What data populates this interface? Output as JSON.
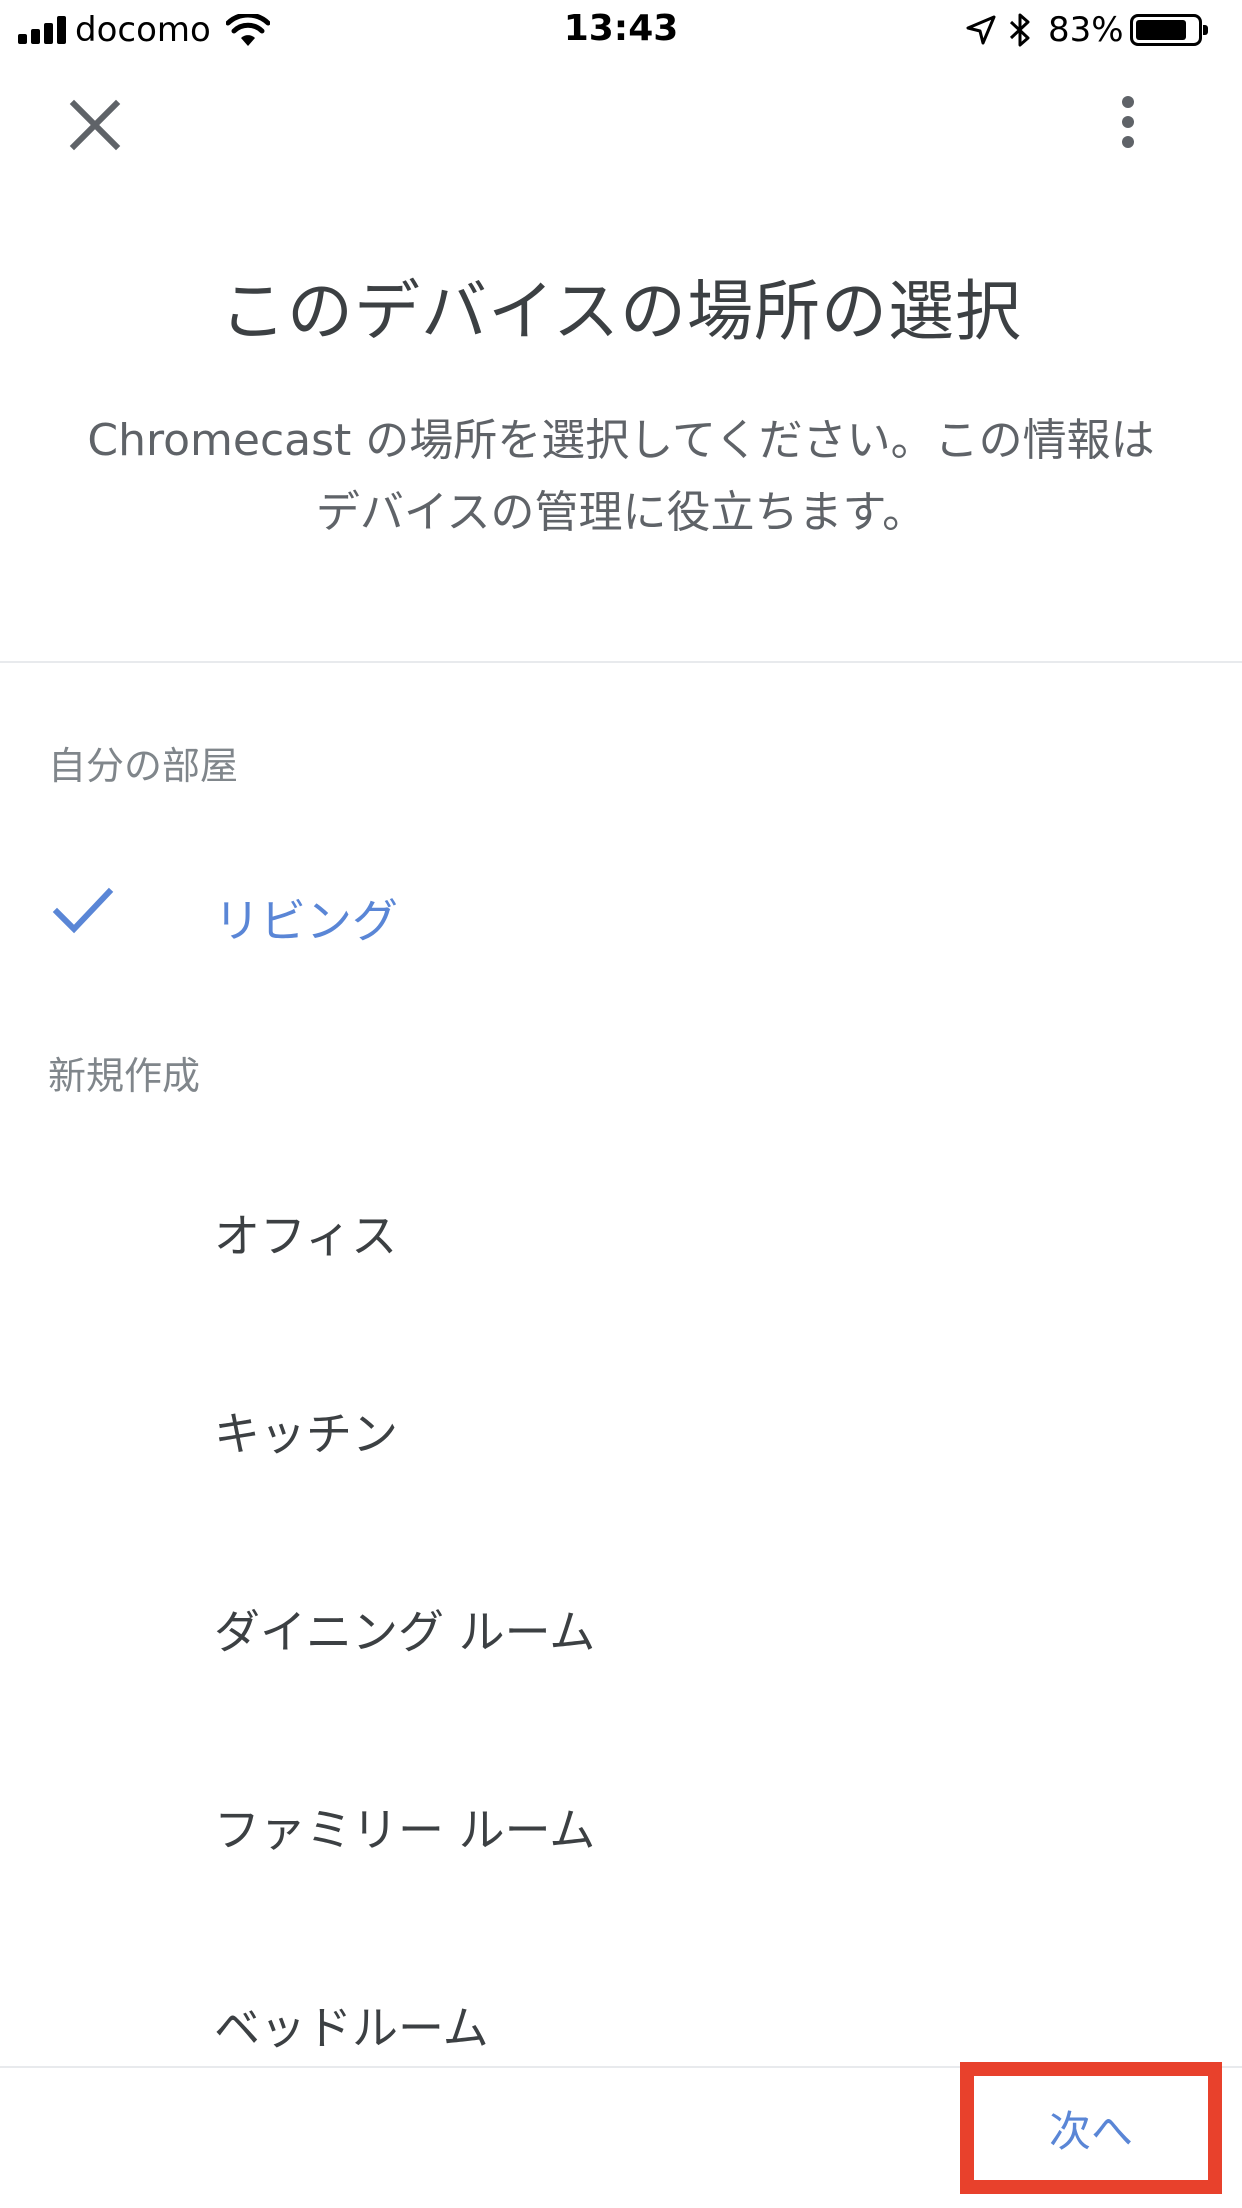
{
  "status_bar": {
    "carrier": "docomo",
    "time": "13:43",
    "battery_percent": "83%",
    "battery_level": 0.83,
    "signal_bars": 4,
    "icons": [
      "signal-icon",
      "wifi-icon",
      "location-icon",
      "bluetooth-icon",
      "battery-icon"
    ]
  },
  "app_bar": {
    "close_icon": "close-icon",
    "more_icon": "more-vert-icon"
  },
  "header": {
    "title": "このデバイスの場所の選択",
    "description": "Chromecast の場所を選択してください。この情報はデバイスの管理に役立ちます。"
  },
  "sections": {
    "my_rooms": {
      "label": "自分の部屋",
      "items": [
        {
          "label": "リビング",
          "selected": true
        }
      ]
    },
    "create_new": {
      "label": "新規作成",
      "items": [
        {
          "label": "オフィス"
        },
        {
          "label": "キッチン"
        },
        {
          "label": "ダイニング ルーム"
        },
        {
          "label": "ファミリー ルーム"
        },
        {
          "label": "ベッドルーム"
        }
      ]
    }
  },
  "footer": {
    "next_label": "次へ"
  },
  "colors": {
    "accent": "#5a86d6",
    "highlight_box": "#e8412c",
    "text": "#3c4043",
    "muted": "#80868b"
  }
}
